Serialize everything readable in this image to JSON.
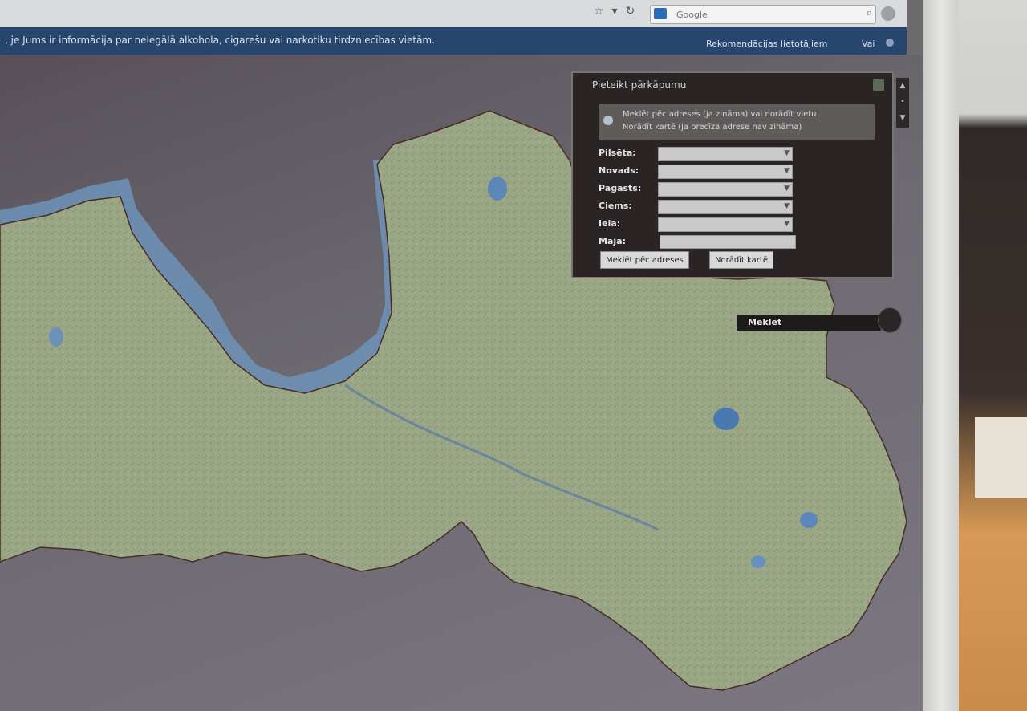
{
  "browser": {
    "search_placeholder": "Google",
    "search_icon": "magnifier-icon",
    "star_icon": "bookmark-star-icon",
    "reload_icon": "reload-icon"
  },
  "header": {
    "notice": ", je Jums ir informācija par nelegālā alkohola, cigarešu vai narkotiku tirdzniecības vietām.",
    "recommendations": "Rekomendācijas lietotājiem",
    "more": "Vai"
  },
  "panel": {
    "title": "Pieteikt pārkāpumu",
    "info_line1": "Meklēt pēc adreses (ja zināma) vai norādīt vietu",
    "info_line2": "Norādīt kartē (ja precīza adrese nav zināma)",
    "fields": {
      "city": "Pilsēta:",
      "county": "Novads:",
      "parish": "Pagasts:",
      "village": "Ciems:",
      "street": "Iela:",
      "house": "Māja:"
    },
    "search_by_address_button": "Meklēt pēc adreses",
    "show_on_map_button": "Norādīt kartē"
  },
  "map_search": {
    "label": "Meklēt"
  },
  "colors": {
    "header_bg": "#26466d",
    "panel_bg": "#2a2524",
    "land": "#9aa784",
    "sea": "#5a5256",
    "coast_shallow": "#6f93b8",
    "border_line": "#4a2b26"
  }
}
